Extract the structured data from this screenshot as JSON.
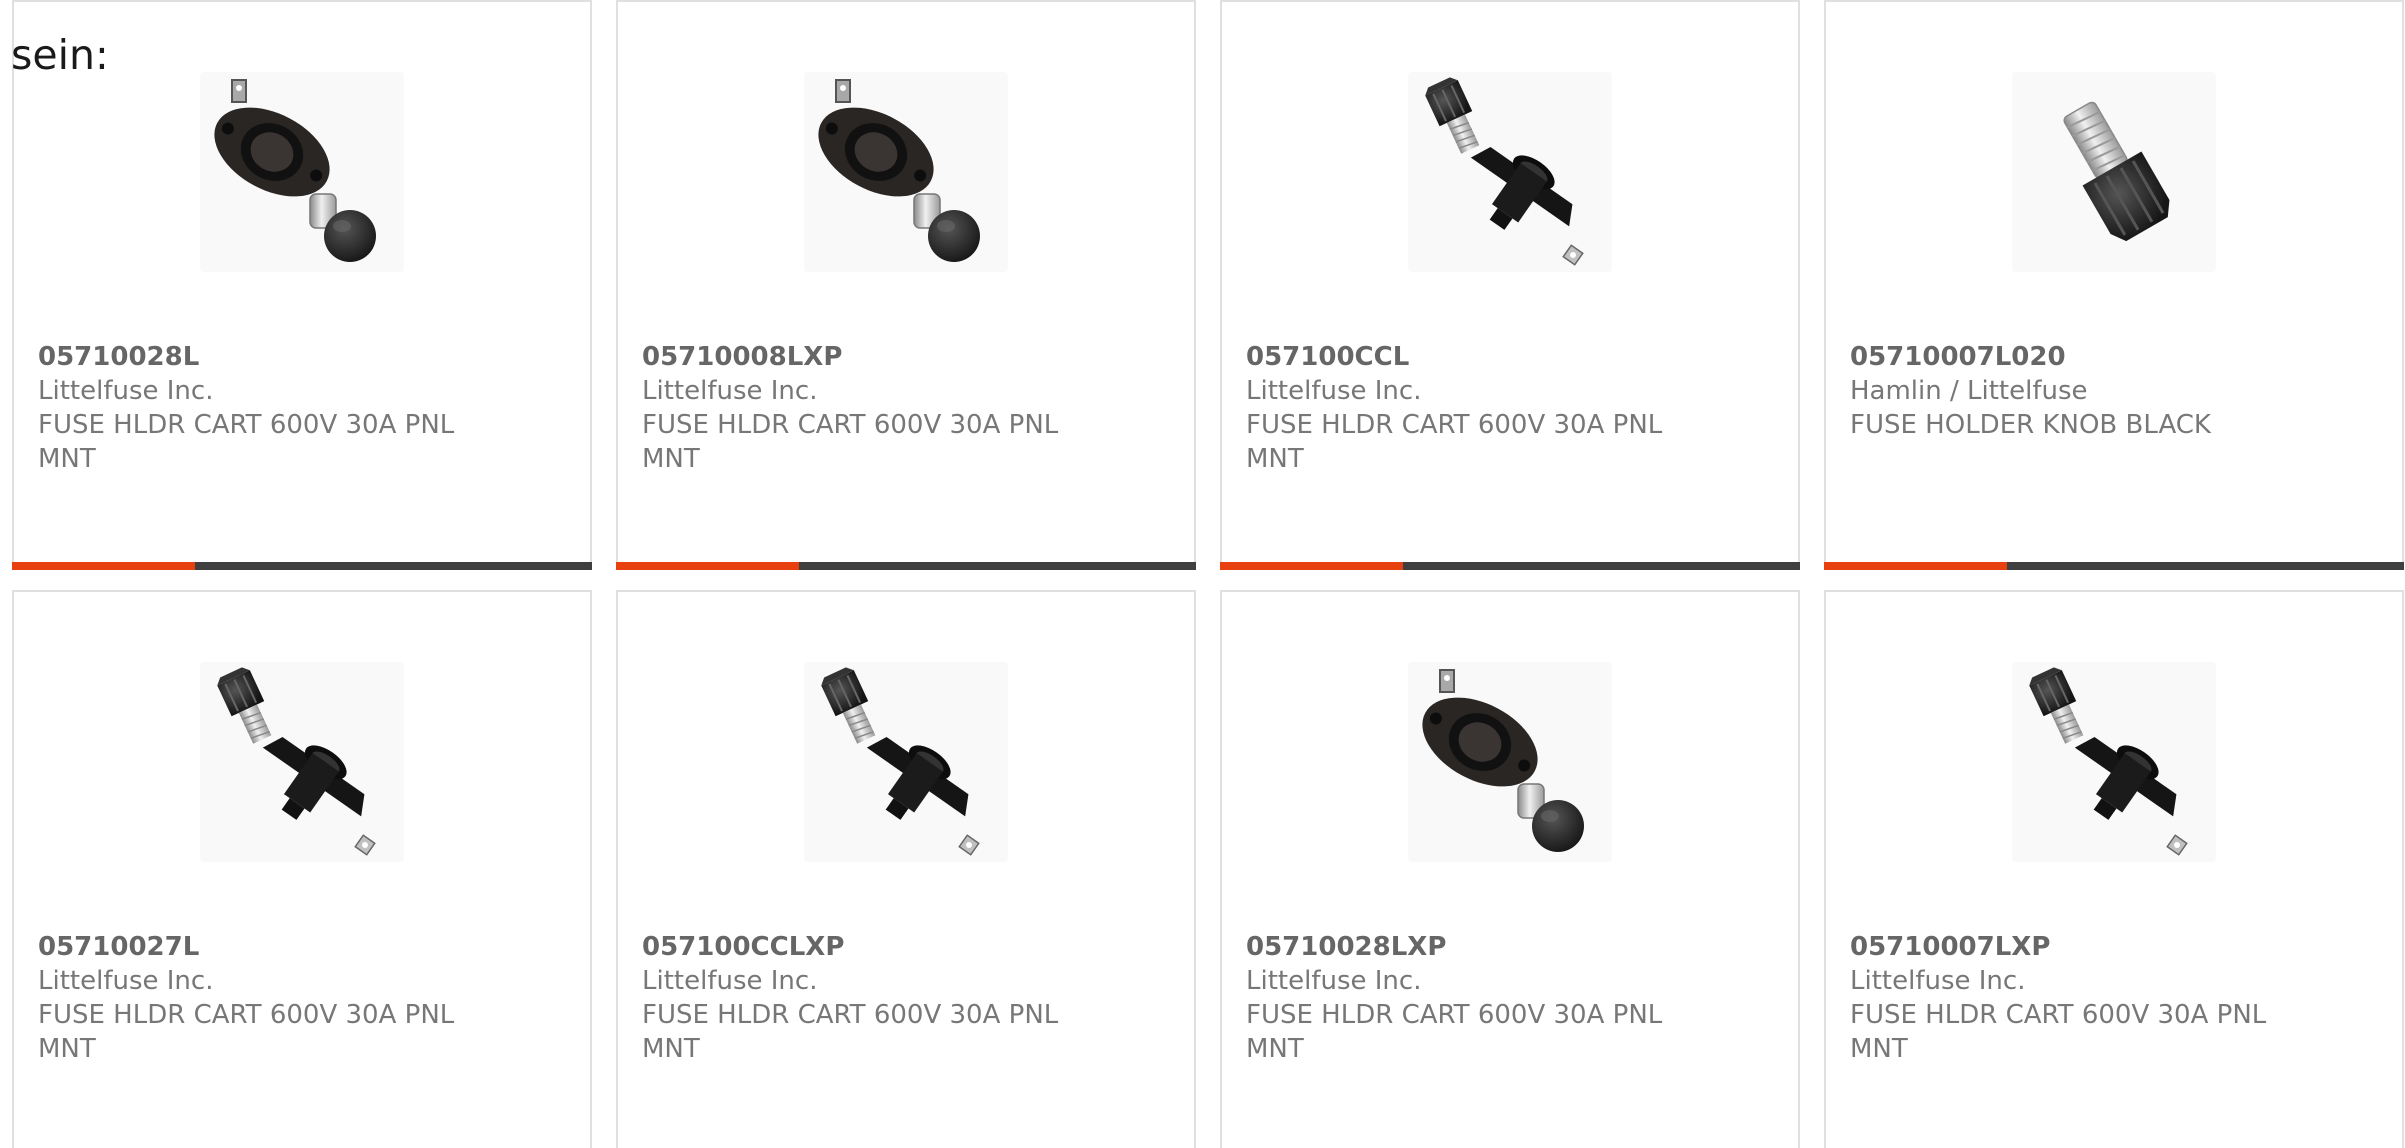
{
  "intro": {
    "text": "sein:"
  },
  "colors": {
    "accent": "#e8410f",
    "bar_track": "#3f3f3f",
    "card_border": "#e0e0e0"
  },
  "products": [
    {
      "part_number": "05710028L",
      "manufacturer": "Littelfuse Inc.",
      "description": "FUSE HLDR CART 600V 30A PNL MNT",
      "image": "oval-flange-fuse-holder-icon",
      "progress": 0.315
    },
    {
      "part_number": "05710008LXP",
      "manufacturer": "Littelfuse Inc.",
      "description": "FUSE HLDR CART 600V 30A PNL MNT",
      "image": "oval-flange-fuse-holder-icon",
      "progress": 0.315
    },
    {
      "part_number": "057100CCL",
      "manufacturer": "Littelfuse Inc.",
      "description": "FUSE HLDR CART 600V 30A PNL MNT",
      "image": "square-flange-fuse-holder-icon",
      "progress": 0.315
    },
    {
      "part_number": "05710007L020",
      "manufacturer": "Hamlin / Littelfuse",
      "description": "FUSE HOLDER KNOB BLACK",
      "image": "fuse-holder-knob-icon",
      "progress": 0.315
    },
    {
      "part_number": "05710027L",
      "manufacturer": "Littelfuse Inc.",
      "description": "FUSE HLDR CART 600V 30A PNL MNT",
      "image": "square-flange-fuse-holder-icon"
    },
    {
      "part_number": "057100CCLXP",
      "manufacturer": "Littelfuse Inc.",
      "description": "FUSE HLDR CART 600V 30A PNL MNT",
      "image": "square-flange-fuse-holder-icon"
    },
    {
      "part_number": "05710028LXP",
      "manufacturer": "Littelfuse Inc.",
      "description": "FUSE HLDR CART 600V 30A PNL MNT",
      "image": "oval-flange-fuse-holder-icon"
    },
    {
      "part_number": "05710007LXP",
      "manufacturer": "Littelfuse Inc.",
      "description": "FUSE HLDR CART 600V 30A PNL MNT",
      "image": "square-flange-fuse-holder-icon"
    }
  ]
}
